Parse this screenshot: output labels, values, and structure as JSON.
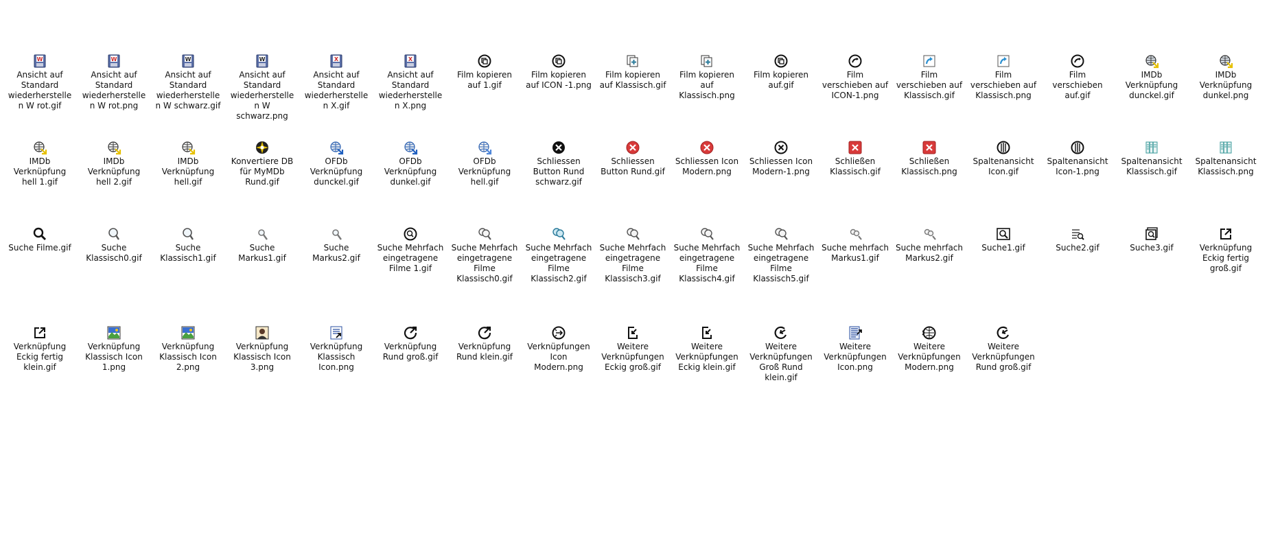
{
  "rows": [
    [
      {
        "label": "Ansicht auf Standard wiederherstellen W rot.gif",
        "icon": "floppy-w-red-icon",
        "color": "#cc2b2b"
      },
      {
        "label": "Ansicht auf Standard wiederherstellen W rot.png",
        "icon": "floppy-w-red-icon",
        "color": "#cc2b2b"
      },
      {
        "label": "Ansicht auf Standard wiederherstellen W schwarz.gif",
        "icon": "floppy-w-black-icon",
        "color": "#222222"
      },
      {
        "label": "Ansicht auf Standard wiederherstellen W schwarz.png",
        "icon": "floppy-w-black-icon",
        "color": "#222222"
      },
      {
        "label": "Ansicht auf Standard wiederherstellen X.gif",
        "icon": "floppy-x-icon",
        "color": "#cc2b2b"
      },
      {
        "label": "Ansicht auf Standard wiederherstellen X.png",
        "icon": "floppy-x-icon",
        "color": "#cc2b2b"
      },
      {
        "label": "Film kopieren auf 1.gif",
        "icon": "film-copy-round-icon",
        "color": "#111111"
      },
      {
        "label": "Film kopieren auf ICON -1.png",
        "icon": "film-copy-round-icon",
        "color": "#111111"
      },
      {
        "label": "Film kopieren auf Klassisch.gif",
        "icon": "film-copy-classic-icon",
        "color": "#2a7a9a"
      },
      {
        "label": "Film kopieren auf Klassisch.png",
        "icon": "film-copy-classic-icon",
        "color": "#2a7a9a"
      },
      {
        "label": "Film kopieren auf.gif",
        "icon": "film-copy-round-icon",
        "color": "#111111"
      },
      {
        "label": "Film verschieben auf ICON-1.png",
        "icon": "film-move-round-icon",
        "color": "#111111"
      },
      {
        "label": "Film verschieben auf Klassisch.gif",
        "icon": "film-move-classic-icon",
        "color": "#2a8fd0"
      },
      {
        "label": "Film verschieben auf Klassisch.png",
        "icon": "film-move-classic-icon",
        "color": "#2a8fd0"
      },
      {
        "label": "Film verschieben auf.gif",
        "icon": "film-move-round-icon",
        "color": "#111111"
      },
      {
        "label": "IMDb Verknüpfung dunckel.gif",
        "icon": "globe-link-icon",
        "color": "#e6c000"
      },
      {
        "label": "IMDb Verknüpfung dunkel.png",
        "icon": "globe-link-icon",
        "color": "#e6c000"
      }
    ],
    [
      {
        "label": "IMDb Verknüpfung hell 1.gif",
        "icon": "globe-link-light-icon",
        "color": "#e6c000"
      },
      {
        "label": "IMDb Verknüpfung hell 2.gif",
        "icon": "globe-link-light-icon",
        "color": "#e6c000"
      },
      {
        "label": "IMDb Verknüpfung hell.gif",
        "icon": "globe-link-light-icon",
        "color": "#e6c000"
      },
      {
        "label": "Konvertiere DB für MyMDb Rund.gif",
        "icon": "convert-db-icon",
        "color": "#e6c000"
      },
      {
        "label": "OFDb Verknüpfung dunckel.gif",
        "icon": "globe-link-blue-icon",
        "color": "#2060c0"
      },
      {
        "label": "OFDb Verknüpfung dunkel.gif",
        "icon": "globe-link-blue-icon",
        "color": "#2060c0"
      },
      {
        "label": "OFDb Verknüpfung hell.gif",
        "icon": "globe-link-blue-light-icon",
        "color": "#4f86d8"
      },
      {
        "label": "Schliessen Button Rund schwarz.gif",
        "icon": "close-round-black-icon",
        "color": "#111111"
      },
      {
        "label": "Schliessen Button Rund.gif",
        "icon": "close-round-red-icon",
        "color": "#d83a3a"
      },
      {
        "label": "Schliessen Icon Modern.png",
        "icon": "close-round-red-icon",
        "color": "#d83a3a"
      },
      {
        "label": "Schliessen Icon Modern-1.png",
        "icon": "close-round-outline-icon",
        "color": "#111111"
      },
      {
        "label": "Schließen Klassisch.gif",
        "icon": "close-square-red-icon",
        "color": "#d83a3a"
      },
      {
        "label": "Schließen Klassisch.png",
        "icon": "close-square-red-icon",
        "color": "#d83a3a"
      },
      {
        "label": "Spaltenansicht Icon.gif",
        "icon": "columns-round-icon",
        "color": "#111111"
      },
      {
        "label": "Spaltenansicht Icon-1.png",
        "icon": "columns-round-icon",
        "color": "#111111"
      },
      {
        "label": "Spaltenansicht Klassisch.gif",
        "icon": "columns-classic-icon",
        "color": "#3a9a9a"
      },
      {
        "label": "Spaltenansicht Klassisch.png",
        "icon": "columns-classic-icon",
        "color": "#3a9a9a"
      }
    ],
    [
      {
        "label": "Suche Filme.gif",
        "icon": "search-icon",
        "color": "#111111"
      },
      {
        "label": "Suche Klassisch0.gif",
        "icon": "search-classic-icon",
        "color": "#555555"
      },
      {
        "label": "Suche Klassisch1.gif",
        "icon": "search-classic-icon",
        "color": "#555555"
      },
      {
        "label": "Suche Markus1.gif",
        "icon": "search-small-icon",
        "color": "#777777"
      },
      {
        "label": "Suche Markus2.gif",
        "icon": "search-small-icon",
        "color": "#777777"
      },
      {
        "label": "Suche Mehrfach eingetragene Filme 1.gif",
        "icon": "search-multi-round-icon",
        "color": "#111111"
      },
      {
        "label": "Suche Mehrfach eingetragene Filme Klassisch0.gif",
        "icon": "search-multi-icon",
        "color": "#555555"
      },
      {
        "label": "Suche Mehrfach eingetragene Filme Klassisch2.gif",
        "icon": "search-multi-color-icon",
        "color": "#2a7a9a"
      },
      {
        "label": "Suche Mehrfach eingetragene Filme Klassisch3.gif",
        "icon": "search-multi-icon",
        "color": "#555555"
      },
      {
        "label": "Suche Mehrfach eingetragene Filme Klassisch4.gif",
        "icon": "search-multi-icon",
        "color": "#555555"
      },
      {
        "label": "Suche Mehrfach eingetragene Filme Klassisch5.gif",
        "icon": "search-multi-icon",
        "color": "#555555"
      },
      {
        "label": "Suche mehrfach Markus1.gif",
        "icon": "search-multi-small-icon",
        "color": "#777777"
      },
      {
        "label": "Suche mehrfach Markus2.gif",
        "icon": "search-multi-small-icon",
        "color": "#777777"
      },
      {
        "label": "Suche1.gif",
        "icon": "search-box-icon",
        "color": "#111111"
      },
      {
        "label": "Suche2.gif",
        "icon": "search-list-icon",
        "color": "#444444"
      },
      {
        "label": "Suche3.gif",
        "icon": "search-stack-icon",
        "color": "#111111"
      },
      {
        "label": "Verknüpfung Eckig fertig groß.gif",
        "icon": "external-link-icon",
        "color": "#111111"
      }
    ],
    [
      {
        "label": "Verknüpfung Eckig fertig klein.gif",
        "icon": "external-link-icon",
        "color": "#111111"
      },
      {
        "label": "Verknüpfung Klassisch Icon 1.png",
        "icon": "picture-link-icon",
        "color": "#2a5fc0"
      },
      {
        "label": "Verknüpfung Klassisch Icon 2.png",
        "icon": "picture-link-icon",
        "color": "#4aa040"
      },
      {
        "label": "Verknüpfung Klassisch Icon 3.png",
        "icon": "portrait-link-icon",
        "color": "#5a3a2a"
      },
      {
        "label": "Verknüpfung Klassisch Icon.png",
        "icon": "document-link-icon",
        "color": "#2a4fa0"
      },
      {
        "label": "Verknüpfung Rund groß.gif",
        "icon": "round-link-icon",
        "color": "#111111"
      },
      {
        "label": "Verknüpfung Rund klein.gif",
        "icon": "round-link-icon",
        "color": "#111111"
      },
      {
        "label": "Verknüpfungen Icon Modern.png",
        "icon": "links-round-icon",
        "color": "#111111"
      },
      {
        "label": "Weitere Verknüpfungen Eckig groß.gif",
        "icon": "more-links-square-icon",
        "color": "#111111"
      },
      {
        "label": "Weitere Verknüpfungen Eckig klein.gif",
        "icon": "more-links-square-icon",
        "color": "#111111"
      },
      {
        "label": "Weitere Verknüpfungen Groß Rund klein.gif",
        "icon": "more-links-round-icon",
        "color": "#111111"
      },
      {
        "label": "Weitere Verknüpfungen Icon.png",
        "icon": "more-links-list-icon",
        "color": "#2a4fa0"
      },
      {
        "label": "Weitere Verknüpfungen Modern.png",
        "icon": "more-links-globe-icon",
        "color": "#111111"
      },
      {
        "label": "Weitere Verknüpfungen Rund groß.gif",
        "icon": "more-links-round-icon",
        "color": "#111111"
      }
    ]
  ]
}
